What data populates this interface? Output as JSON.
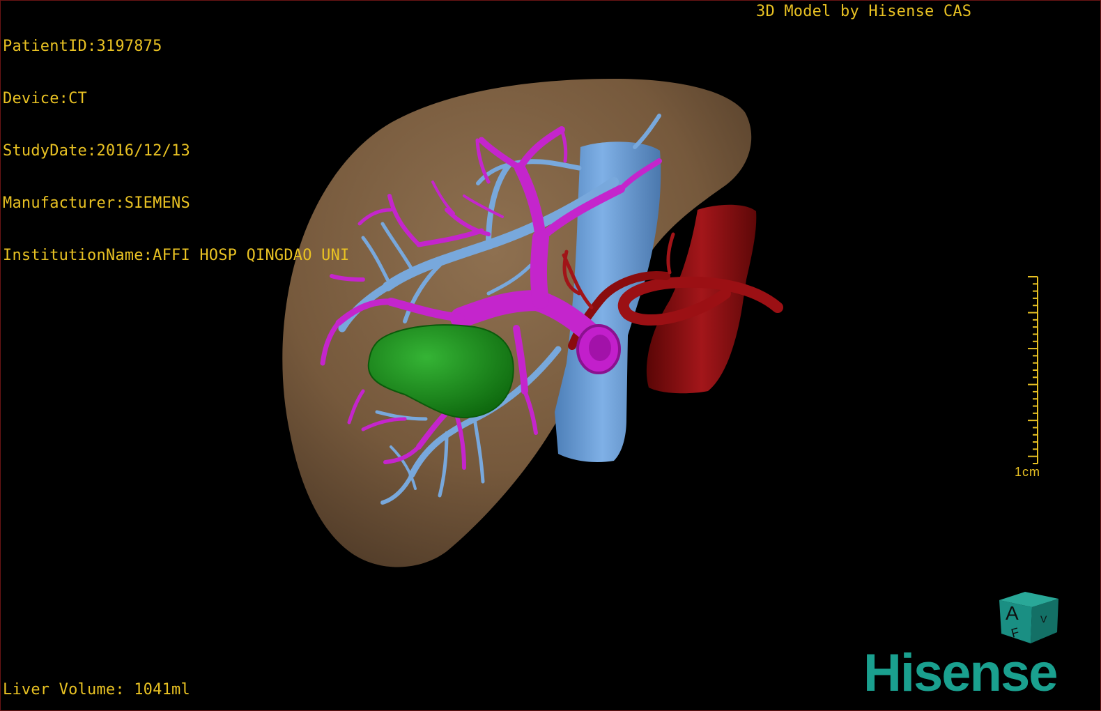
{
  "patient_info": {
    "patient_id": "PatientID:3197875",
    "device": "Device:CT",
    "study_date": "StudyDate:2016/12/13",
    "manufacturer": "Manufacturer:SIEMENS",
    "institution": "InstitutionName:AFFI HOSP QINGDAO UNI"
  },
  "model_credit": "3D Model by Hisense CAS",
  "liver_volume": "Liver Volume: 1041ml",
  "scale_bar": {
    "label": "1cm"
  },
  "orientation_cube": {
    "front_letter": "A",
    "bottom_letter": "F",
    "side_letter": "V",
    "color": "#1a8f83"
  },
  "brand": {
    "name": "Hisense",
    "color": "#1aa08f"
  },
  "colors": {
    "overlay_text": "#e9c223",
    "liver": "#7d6143",
    "portal_vein": "#c023c8",
    "hepatic_vein": "#6fa0d8",
    "artery_aorta": "#8c0c0c",
    "tumor": "#1a8a1a",
    "background": "#000000"
  },
  "structures": [
    {
      "name": "liver",
      "icon": "liver-surface"
    },
    {
      "name": "portal-vein",
      "icon": "vessel-tree-magenta"
    },
    {
      "name": "hepatic-vein",
      "icon": "vessel-tree-blue"
    },
    {
      "name": "inferior-vena-cava",
      "icon": "vessel-trunk-blue"
    },
    {
      "name": "aorta",
      "icon": "vessel-trunk-red"
    },
    {
      "name": "tumor",
      "icon": "lesion-green"
    }
  ]
}
